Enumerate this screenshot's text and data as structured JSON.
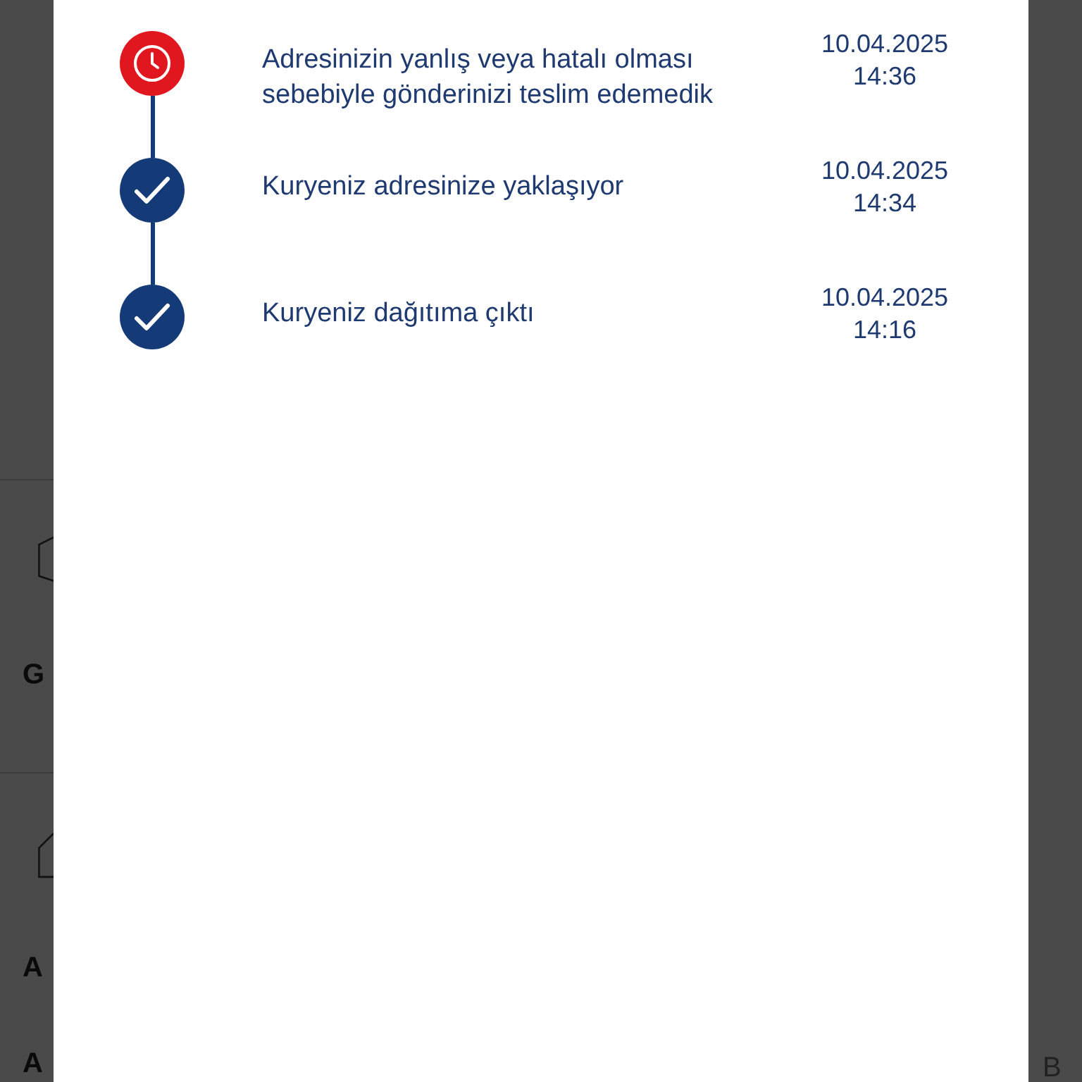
{
  "background_page": {
    "left_fragments": [
      {
        "kind": "box-icon"
      },
      {
        "kind": "text",
        "text": "G"
      },
      {
        "kind": "divider"
      },
      {
        "kind": "house-icon"
      },
      {
        "kind": "text",
        "text": "A"
      },
      {
        "kind": "text",
        "text": "A"
      }
    ],
    "right_fragment": "B"
  },
  "timeline": [
    {
      "kind": "failed",
      "message": "Adresinizin yanlış veya hatalı olması sebebiyle gönderinizi teslim edemedik",
      "date": "10.04.2025",
      "time": "14:36"
    },
    {
      "kind": "done",
      "message": "Kuryeniz adresinize yaklaşıyor",
      "date": "10.04.2025",
      "time": "14:34"
    },
    {
      "kind": "done",
      "message": "Kuryeniz dağıtıma çıktı",
      "date": "10.04.2025",
      "time": "14:16"
    }
  ]
}
